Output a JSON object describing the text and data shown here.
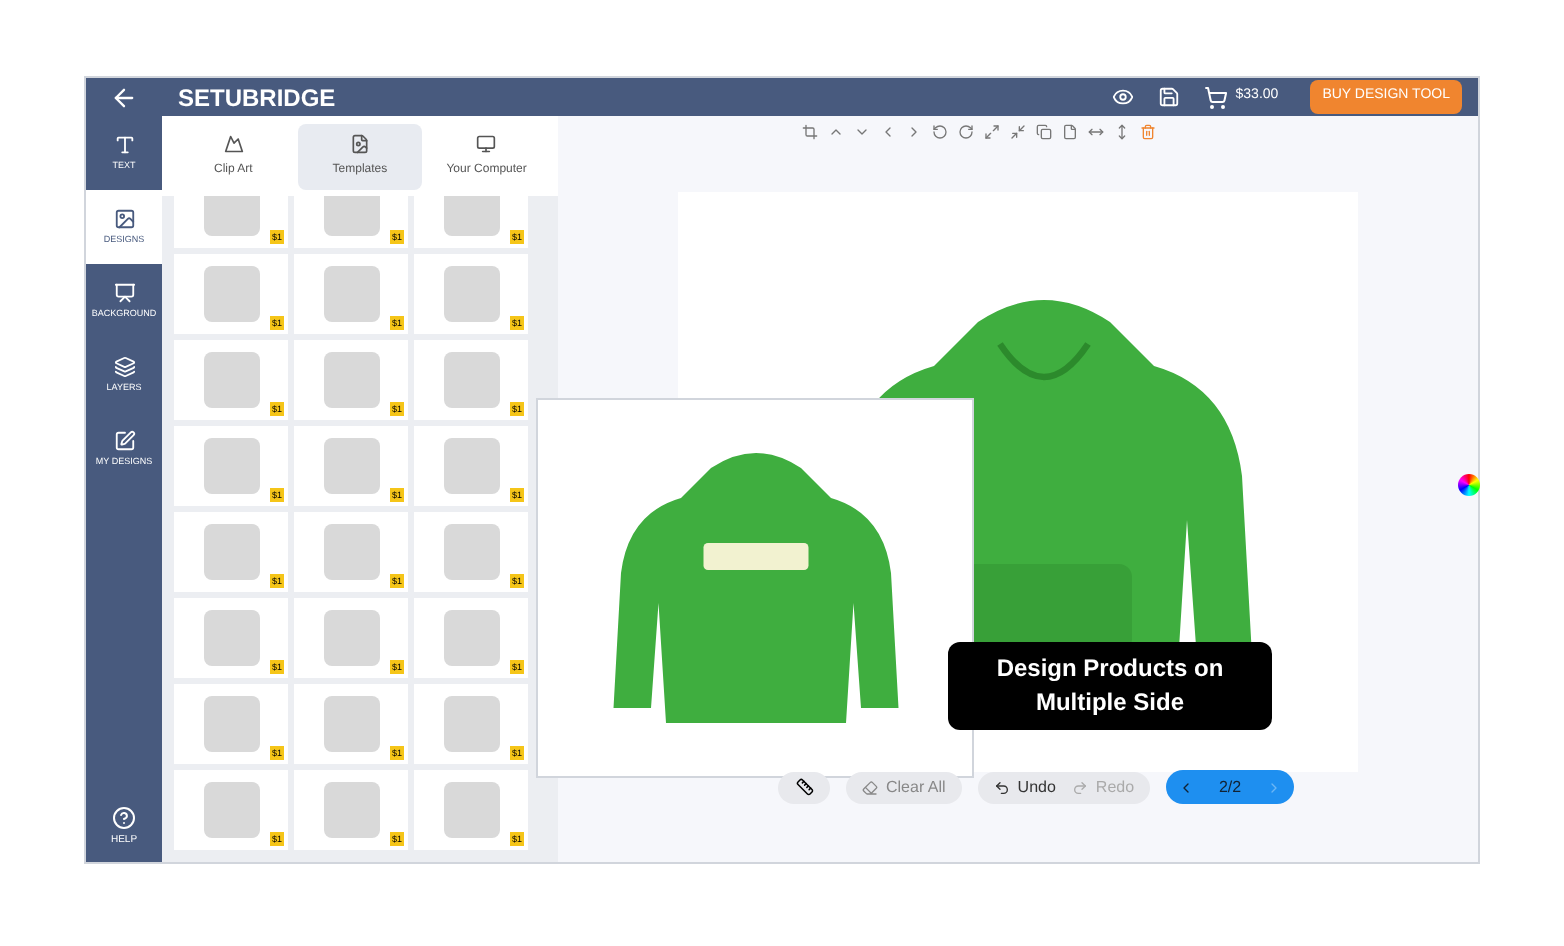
{
  "header": {
    "brand": "SETUBRIDGE",
    "price": "$33.00",
    "buy_button": "BUY DESIGN TOOL"
  },
  "nav": [
    {
      "label": "TEXT",
      "kind": "text",
      "selected": false
    },
    {
      "label": "DESIGNS",
      "kind": "designs",
      "selected": true
    },
    {
      "label": "BACKGROUND",
      "kind": "background",
      "selected": false
    },
    {
      "label": "LAYERS",
      "kind": "layers",
      "selected": false
    },
    {
      "label": "MY DESIGNS",
      "kind": "mydesigns",
      "selected": false
    }
  ],
  "help": "HELP",
  "tabs": [
    {
      "label": "Clip Art",
      "kind": "clipart",
      "selected": false
    },
    {
      "label": "Templates",
      "kind": "templates",
      "selected": true
    },
    {
      "label": "Your Computer",
      "kind": "computer",
      "selected": false
    }
  ],
  "designs": [
    {
      "price": "$1"
    },
    {
      "price": "$1"
    },
    {
      "price": "$1"
    },
    {
      "price": "$1"
    },
    {
      "price": "$1"
    },
    {
      "price": "$1"
    },
    {
      "price": "$1"
    },
    {
      "price": "$1"
    },
    {
      "price": "$1"
    },
    {
      "price": "$1"
    },
    {
      "price": "$1"
    },
    {
      "price": "$1"
    },
    {
      "price": "$1"
    },
    {
      "price": "$1"
    },
    {
      "price": "$1"
    },
    {
      "price": "$1"
    },
    {
      "price": "$1"
    },
    {
      "price": "$1"
    },
    {
      "price": "$1"
    },
    {
      "price": "$1"
    },
    {
      "price": "$1"
    },
    {
      "price": "$1"
    },
    {
      "price": "$1"
    },
    {
      "price": "$1"
    }
  ],
  "callout": "Design Products on Multiple Side",
  "controls": {
    "clear": "Clear All",
    "undo": "Undo",
    "redo": "Redo",
    "redo_disabled": true,
    "page": "2/2"
  }
}
